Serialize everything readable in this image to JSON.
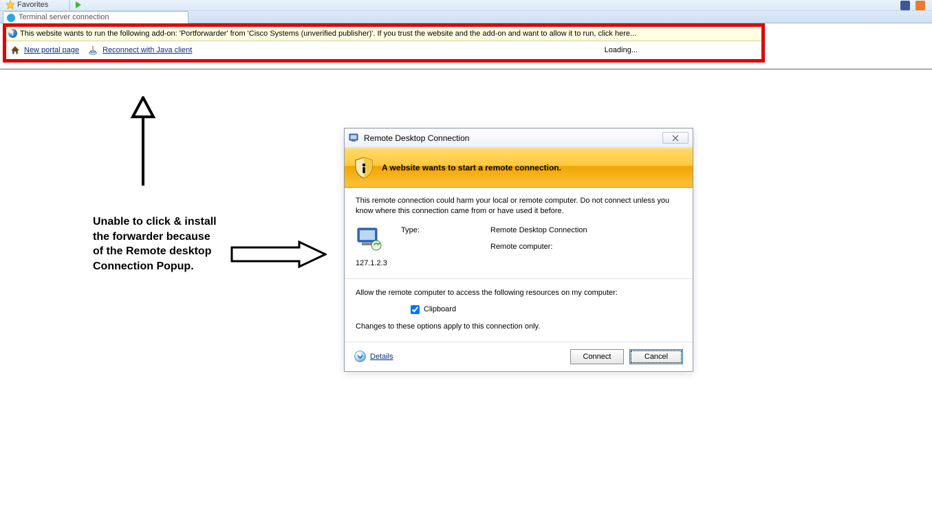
{
  "browser": {
    "favorites_label": "Favorites",
    "tab_title": "Terminal server connection"
  },
  "infobar": {
    "text": "This website wants to run the following add-on: 'Portforwarder' from 'Cisco Systems (unverified publisher)'. If you trust the website and the add-on and want to allow it to run, click here..."
  },
  "links": {
    "new_portal": "New portal page",
    "reconnect": "Reconnect with Java client",
    "loading": "Loading..."
  },
  "annotation": {
    "text": "Unable to click & install the forwarder because of the Remote desktop Connection Popup."
  },
  "dialog": {
    "title": "Remote Desktop Connection",
    "close": "×",
    "banner": "A website wants to start a remote connection.",
    "desc": "This remote connection could harm your local or remote computer. Do not connect unless you know where this connection came from or have used it before.",
    "type_label": "Type:",
    "type_value": "Remote Desktop Connection",
    "remote_label": "Remote computer:",
    "remote_value": "127.1.2.3",
    "allow_text": "Allow the remote computer to access the following resources on my computer:",
    "clipboard": "Clipboard",
    "apply_text": "Changes to these options apply to this connection only.",
    "details": "Details",
    "connect": "Connect",
    "cancel": "Cancel"
  }
}
